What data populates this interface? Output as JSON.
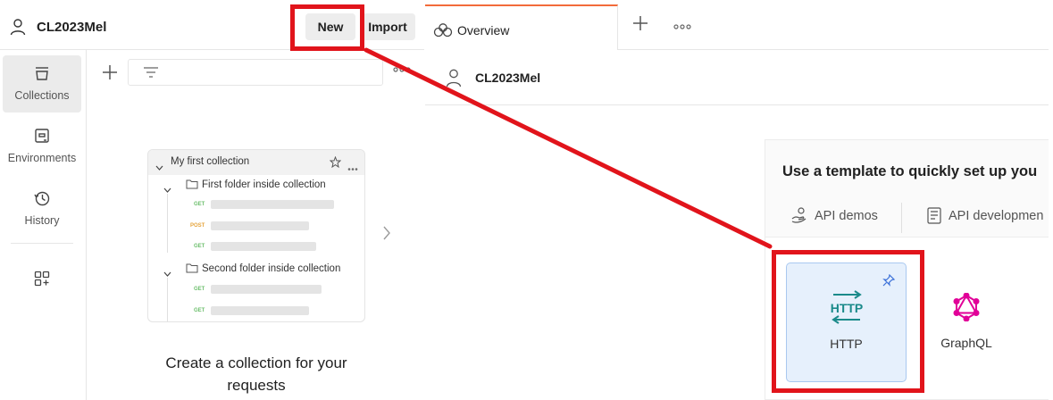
{
  "workspace": {
    "name": "CL2023Mel"
  },
  "header_buttons": {
    "new_label": "New",
    "import_label": "Import"
  },
  "rail": {
    "items": [
      {
        "label": "Collections",
        "icon": "collections-icon",
        "active": true
      },
      {
        "label": "Environments",
        "icon": "environments-icon",
        "active": false
      },
      {
        "label": "History",
        "icon": "history-icon",
        "active": false
      },
      {
        "label": "",
        "icon": "configure-workbench-icon",
        "active": false
      }
    ]
  },
  "illustration": {
    "collection_name": "My first collection",
    "folders": [
      {
        "name": "First folder inside collection",
        "requests": [
          "GET",
          "POST",
          "GET"
        ]
      },
      {
        "name": "Second folder inside collection",
        "requests": [
          "GET",
          "GET"
        ]
      }
    ]
  },
  "empty_state": {
    "title": "Create a collection for your requests"
  },
  "tabs": [
    {
      "label": "Overview",
      "icon": "overview-icon",
      "active": true
    }
  ],
  "overview": {
    "workspace_name": "CL2023Mel"
  },
  "templates": {
    "title": "Use a template to quickly set up you",
    "tabs": [
      {
        "label": "API demos",
        "icon": "api-demos-icon"
      },
      {
        "label": "API developmen",
        "icon": "api-development-icon"
      }
    ],
    "cards": [
      {
        "label": "HTTP",
        "icon": "http-icon",
        "pinned": true,
        "selected": true
      },
      {
        "label": "GraphQL",
        "icon": "graphql-icon",
        "pinned": false,
        "selected": false
      }
    ]
  },
  "annotation": {
    "color": "#e1141b"
  },
  "colors": {
    "accent": "#f26b3a",
    "http_teal": "#1a8a8a",
    "graphql_pink": "#e10098",
    "get": "#6dbf6d",
    "post": "#e5a43c"
  }
}
